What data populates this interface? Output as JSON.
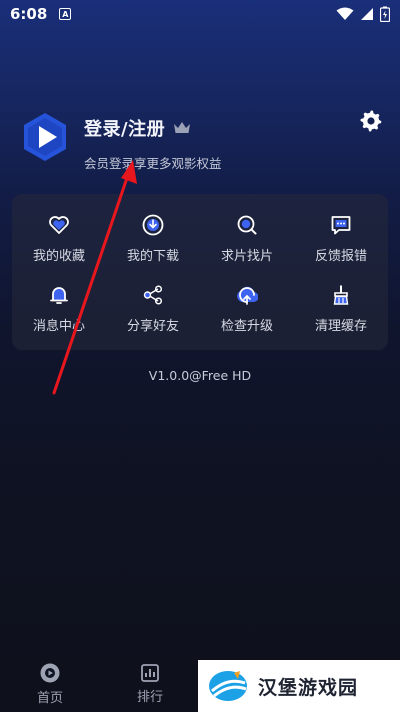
{
  "status_bar": {
    "time": "6:08",
    "notification": "A"
  },
  "header": {
    "login_title": "登录/注册",
    "login_subtitle": "会员登录享更多观影权益"
  },
  "grid": [
    {
      "label": "我的收藏",
      "icon": "heart-icon"
    },
    {
      "label": "我的下载",
      "icon": "download-icon"
    },
    {
      "label": "求片找片",
      "icon": "search-film-icon"
    },
    {
      "label": "反馈报错",
      "icon": "feedback-icon"
    },
    {
      "label": "消息中心",
      "icon": "bell-icon"
    },
    {
      "label": "分享好友",
      "icon": "share-icon"
    },
    {
      "label": "检查升级",
      "icon": "upgrade-icon"
    },
    {
      "label": "清理缓存",
      "icon": "broom-icon"
    }
  ],
  "version": "V1.0.0@Free HD",
  "bottom_nav": [
    {
      "label": "首页",
      "icon": "home-icon"
    },
    {
      "label": "排行",
      "icon": "rank-icon"
    }
  ],
  "watermark": {
    "text": "汉堡游戏园"
  },
  "colors": {
    "accent": "#4a6cff",
    "icon_fill": "#3d63f0",
    "background": "#0f1221"
  }
}
